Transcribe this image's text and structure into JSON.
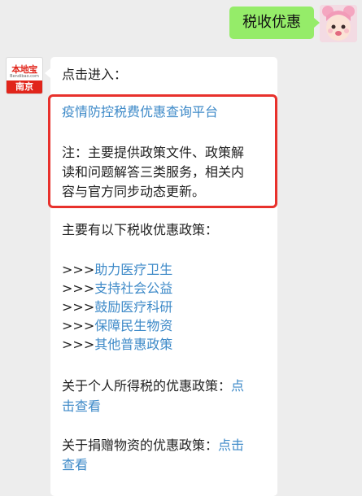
{
  "user_message": {
    "text": "税收优惠"
  },
  "account": {
    "logo_text": "本地宝",
    "logo_url": "Bendibao.com",
    "city": "南京"
  },
  "message": {
    "intro": "点击进入：",
    "platform_link": "疫情防控税费优惠查询平台",
    "note_lines": [
      "注：主要提供政策文件、政策解",
      "读和问题解答三类服务，相关内",
      "容与官方同步动态更新。"
    ],
    "policies_heading": "主要有以下税收优惠政策：",
    "policy_prefix": ">>>",
    "policies": [
      "助力医疗卫生",
      "支持社会公益",
      "鼓励医疗科研",
      "保障民生物资",
      "其他普惠政策"
    ],
    "personal_tax_label": "关于个人所得税的优惠政策：",
    "personal_tax_link_a": "点",
    "personal_tax_link_b": "击查看",
    "donation_label": "关于捐赠物资的优惠政策：",
    "donation_link_a": "点击",
    "donation_link_b": "查看"
  },
  "colors": {
    "link": "#3e8ac8",
    "highlight_border": "#e8312c",
    "out_bubble": "#95ec69",
    "background": "#ededed"
  }
}
